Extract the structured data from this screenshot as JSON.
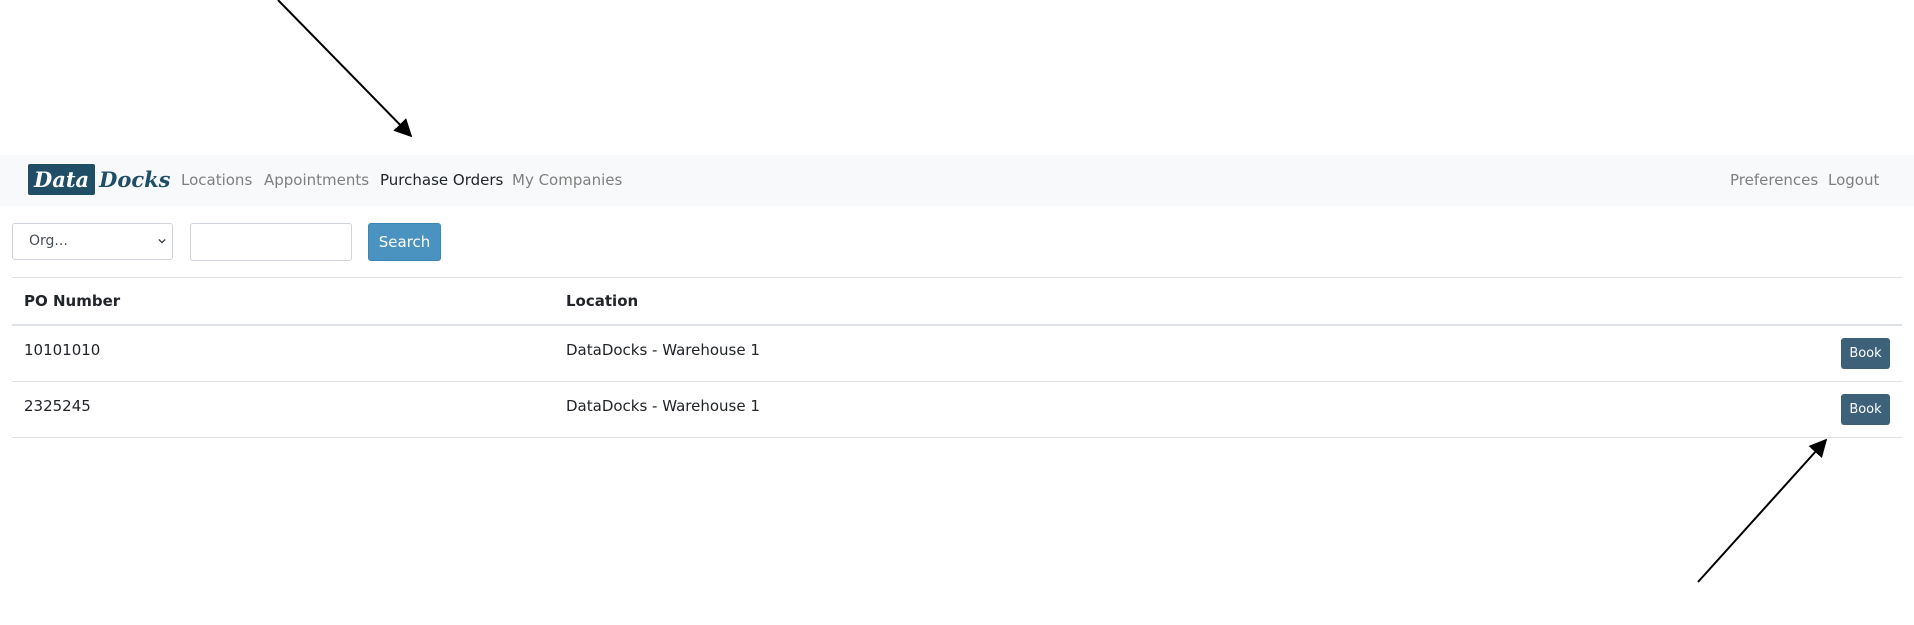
{
  "brand": {
    "part1": "Data",
    "part2": "Docks"
  },
  "nav": {
    "locations": "Locations",
    "appointments": "Appointments",
    "purchase_orders": "Purchase Orders",
    "my_companies": "My Companies",
    "preferences": "Preferences",
    "logout": "Logout"
  },
  "filters": {
    "org_selected": "Org...",
    "search_value": "",
    "search_button": "Search"
  },
  "table": {
    "headers": {
      "po_number": "PO Number",
      "location": "Location"
    },
    "rows": [
      {
        "po_number": "10101010",
        "location": "DataDocks - Warehouse 1",
        "action": "Book"
      },
      {
        "po_number": "2325245",
        "location": "DataDocks - Warehouse 1",
        "action": "Book"
      }
    ]
  },
  "colors": {
    "brand": "#1f4e66",
    "navbar_bg": "#f8f9fa",
    "search_button": "#4a93c1",
    "book_button": "#3d6178"
  }
}
